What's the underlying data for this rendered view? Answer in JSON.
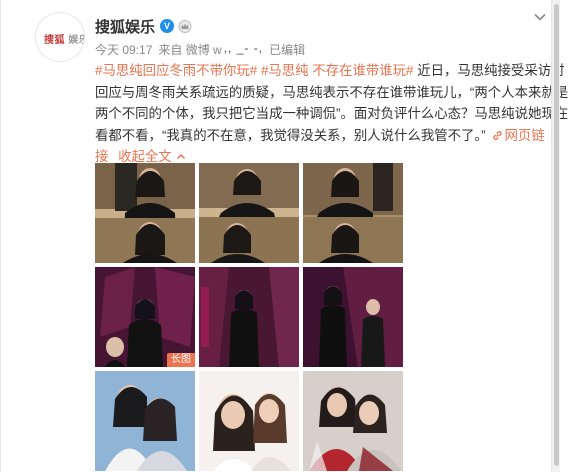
{
  "post": {
    "user_name": "搜狐娱乐",
    "verified_mark": "V",
    "time": "今天 09:17",
    "source_prefix": "来自 微博 w",
    "source_obscured": ",, _- -,",
    "edited": "已编辑",
    "lines": [
      [
        "#马思纯回应冬雨不带你玩#",
        " ",
        "#马思纯 不存在谁带谁玩#",
        " 近日，马思纯接受采访时"
      ],
      [
        "回应与周冬雨关系疏远的质疑，马思纯表示不存在谁带谁玩儿，“两个人本来就是"
      ],
      [
        "两个不同的个体，我只把它当成一种调侃”。面对负评什么心态？马思纯说她现在"
      ],
      [
        "看都不看，“我真的不在意，我觉得没关系，别人说什么我管不了。”",
        "网页链"
      ],
      [
        "接",
        "收起全文"
      ]
    ],
    "avatar_logo_text": "搜狐",
    "avatar_logo_text2": "娱乐",
    "long_image_badge": "长图"
  },
  "icons": {
    "verified": "verified-v-icon",
    "crown": "crown-icon",
    "more": "chevron-down-icon",
    "link": "link-icon",
    "collapse": "chevron-up-icon"
  },
  "colors": {
    "accent": "#eb7350",
    "text": "#333333",
    "meta": "#888888",
    "verified": "#1e8ee8"
  }
}
